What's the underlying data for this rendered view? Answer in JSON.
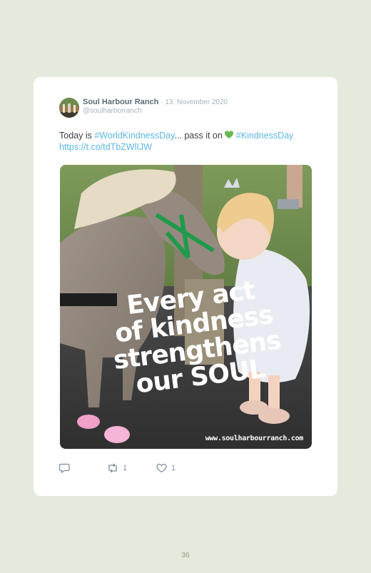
{
  "tweet": {
    "author_name": "Soul Harbour Ranch",
    "separator": " · ",
    "date": "13. November 2020",
    "handle": "@soulharborranch",
    "text_part1": "Today is ",
    "hashtag1": "#WorldKindnessDay",
    "text_part2": "... pass it on ",
    "heart_emoji": "green-heart",
    "hashtag2": "#KindnessDay",
    "link": "https://t.co/tdTbZWlIJW"
  },
  "image": {
    "overlay_line1": "Every act",
    "overlay_line2": "of kindness",
    "overlay_line3": "strengthens",
    "overlay_line4": "our SOUL",
    "watermark": "www.soulharbourranch.com"
  },
  "actions": {
    "reply_icon": "reply-icon",
    "retweet_icon": "retweet-icon",
    "retweet_count": "1",
    "like_icon": "heart-icon",
    "like_count": "1"
  },
  "page": {
    "number": "36"
  },
  "colors": {
    "background": "#e5ebdc",
    "link": "#5cb7e6",
    "heart": "#69b84f"
  }
}
